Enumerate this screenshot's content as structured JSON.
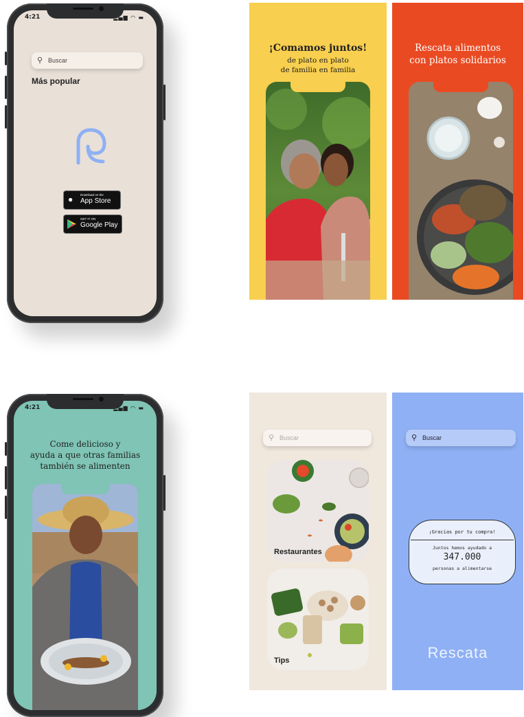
{
  "phone_top": {
    "time": "4:21",
    "search_placeholder": "Buscar",
    "section_title": "Más popular",
    "app_store_small": "Download on the",
    "app_store_big": "App Store",
    "google_play_small": "GET IT ON",
    "google_play_big": "Google Play"
  },
  "panel_yellow": {
    "title_line1": "¡Comamos juntos!",
    "title_line2": "de plato en plato",
    "title_line3": "de familia en familia",
    "bg": "#f8cf4e"
  },
  "panel_red": {
    "title_line1": "Rescata alimentos",
    "title_line2": "con platos solidarios",
    "bg": "#ea4a22"
  },
  "phone_bottom": {
    "time": "4:21",
    "title_line1": "Come delicioso y",
    "title_line2": "ayuda a que otras familias",
    "title_line3": "también se alimenten",
    "bg": "#7fc4b4"
  },
  "panel_beige": {
    "search_placeholder": "Buscar",
    "card1_label": "Restaurantes",
    "card2_label": "Tips",
    "bg": "#f0e7dd"
  },
  "panel_blue": {
    "search_placeholder": "Buscar",
    "receipt_title": "¡Gracias por tu compra!",
    "receipt_line1": "Juntos hemos ayudado a",
    "receipt_count": "347.000",
    "receipt_line2": "personas a alimentarse",
    "brand": "Rescata",
    "bg": "#8fb0f4"
  }
}
